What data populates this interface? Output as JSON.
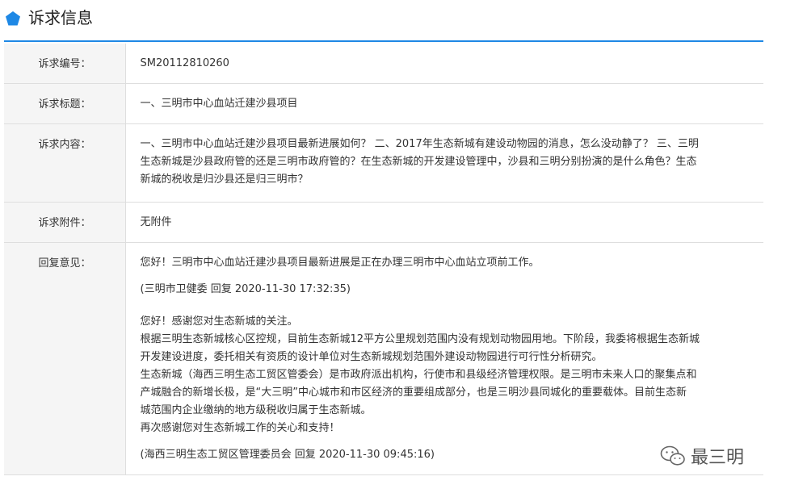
{
  "header": {
    "title": "诉求信息",
    "icon": "pentagon-icon",
    "accent": "#1e88e5"
  },
  "rows": {
    "number": {
      "label": "诉求编号：",
      "value": "SM20112810260"
    },
    "title": {
      "label": "诉求标题：",
      "value": "一、三明市中心血站迁建沙县项目"
    },
    "content": {
      "label": "诉求内容：",
      "lines": [
        "一、三明市中心血站迁建沙县项目最新进展如何？ 二、2017年生态新城有建设动物园的消息，怎么没动静了？ 三、三明",
        "生态新城是沙县政府管的还是三明市政府管的？在生态新城的开发建设管理中，沙县和三明分别扮演的是什么角色？生态",
        "新城的税收是归沙县还是归三明市？"
      ]
    },
    "attachment": {
      "label": "诉求附件：",
      "value": "无附件"
    },
    "reply": {
      "label": "回复意见：",
      "reply1": {
        "text": "您好！三明市中心血站迁建沙县项目最新进展是正在办理三明市中心血站立项前工作。",
        "sign": "(三明市卫健委 回复 2020-11-30 17:32:35)"
      },
      "reply2": {
        "lines": [
          "您好！感谢您对生态新城的关注。",
          "根据三明生态新城核心区控规，目前生态新城12平方公里规划范围内没有规划动物园用地。下阶段，我委将根据生态新城",
          "开发建设进度，委托相关有资质的设计单位对生态新城规划范围外建设动物园进行可行性分析研究。",
          "生态新城（海西三明生态工贸区管委会）是市政府派出机构，行使市和县级经济管理权限。是三明市未来人口的聚集点和",
          "产城融合的新增长极，是“大三明”中心城市和市区经济的重要组成部分，也是三明沙县同城化的重要载体。目前生态新",
          "城范围内企业缴纳的地方级税收归属于生态新城。",
          "再次感谢您对生态新城工作的关心和支持！"
        ],
        "sign": "(海西三明生态工贸区管理委员会 回复 2020-11-30 09:45:16)"
      }
    }
  },
  "watermark": {
    "text": "最三明",
    "icon": "wechat-icon"
  }
}
